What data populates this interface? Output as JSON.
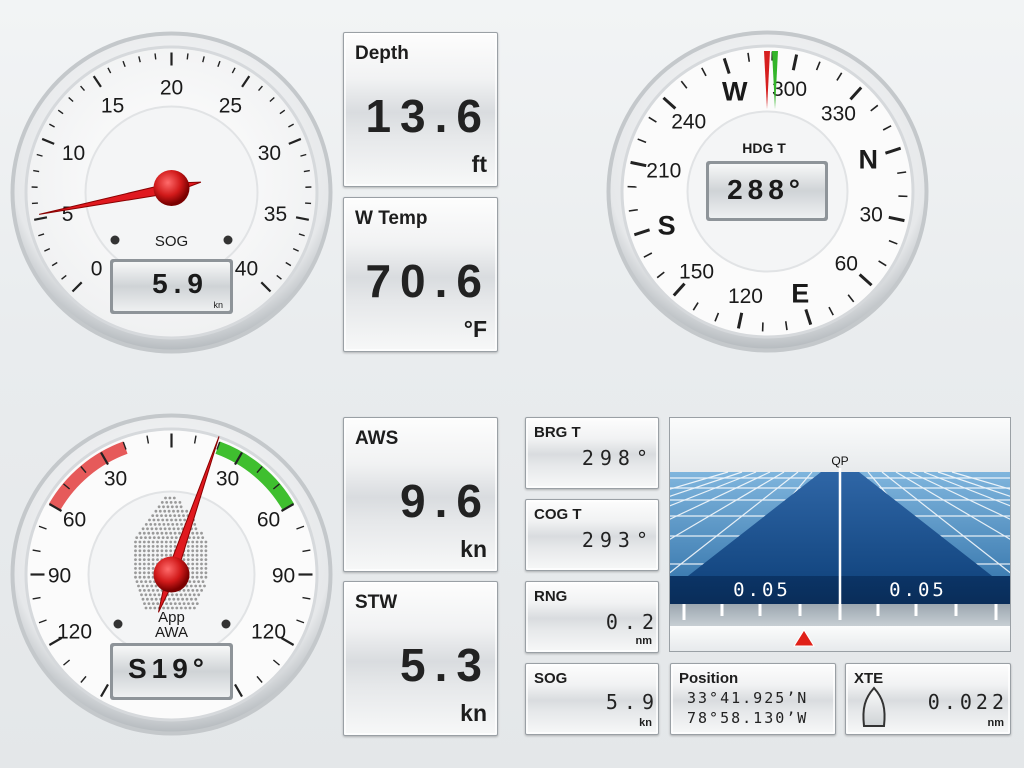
{
  "sog_gauge": {
    "ticks": [
      "0",
      "5",
      "10",
      "15",
      "20",
      "25",
      "30",
      "35",
      "40"
    ],
    "label": "SOG",
    "value": "5.9",
    "unit": "kn",
    "needle_value": 5
  },
  "compass": {
    "labels": [
      "N",
      "30",
      "60",
      "E",
      "120",
      "150",
      "S",
      "210",
      "240",
      "W",
      "300",
      "330"
    ],
    "label": "HDG T",
    "value": "288°",
    "heading": 288
  },
  "wind_gauge": {
    "ticks": [
      "30",
      "60",
      "90",
      "120",
      "30",
      "60",
      "90",
      "120"
    ],
    "label_line1": "App",
    "label_line2": "AWA",
    "value": "S19°",
    "angle_value": 19,
    "colors": {
      "port": "#e65a5a",
      "starboard": "#3fbf2f"
    }
  },
  "panels": {
    "depth": {
      "label": "Depth",
      "value": "13.6",
      "unit": "ft"
    },
    "water_temp": {
      "label": "W Temp",
      "value": "70.6",
      "unit": "°F"
    },
    "aws": {
      "label": "AWS",
      "value": "9.6",
      "unit": "kn"
    },
    "stw": {
      "label": "STW",
      "value": "5.3",
      "unit": "kn"
    },
    "brg": {
      "label": "BRG T",
      "value": "298°"
    },
    "cog": {
      "label": "COG T",
      "value": "293°"
    },
    "rng": {
      "label": "RNG",
      "value": "0.2",
      "unit": "nm"
    },
    "sog": {
      "label": "SOG",
      "value": "5.9",
      "unit": "kn"
    },
    "position": {
      "label": "Position",
      "lat": "33°41.925’N",
      "lon": "78°58.130’W"
    },
    "xte": {
      "label": "XTE",
      "value": "0.022",
      "unit": "nm"
    }
  },
  "highway": {
    "waypoint": "QP",
    "left_value": "0.05",
    "right_value": "0.05"
  }
}
